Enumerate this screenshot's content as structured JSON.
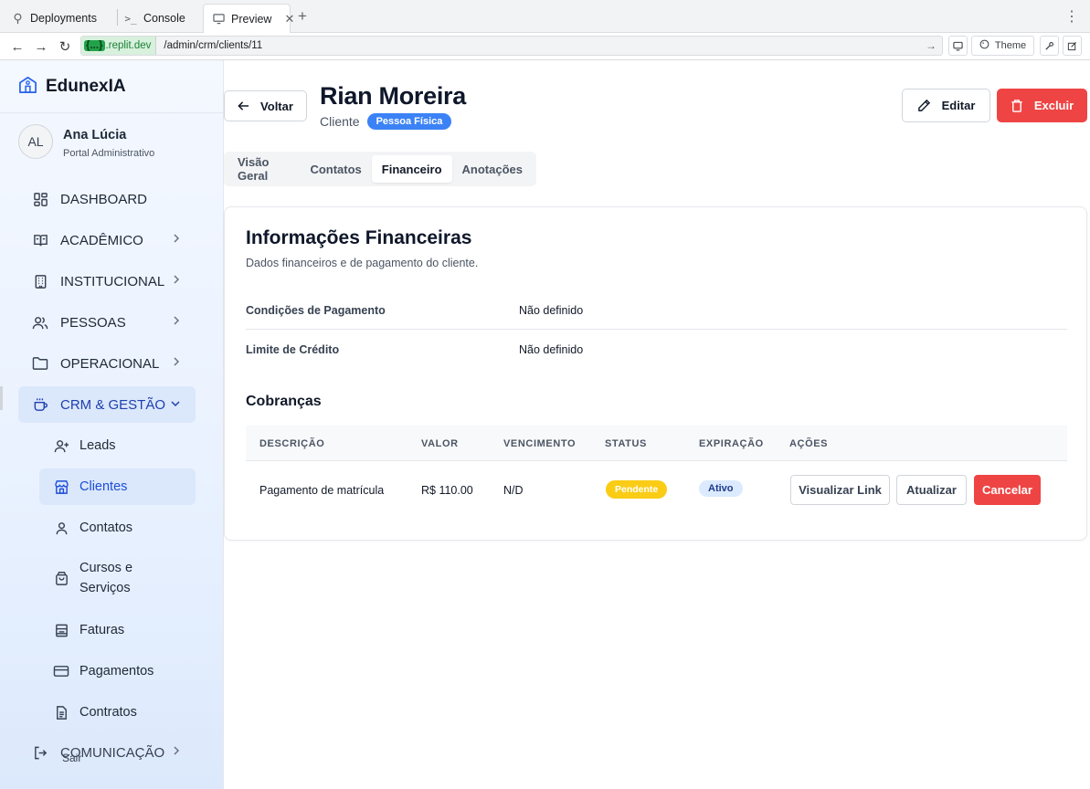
{
  "browser": {
    "tabs": [
      {
        "label": "Deployments",
        "icon": "tree-icon"
      },
      {
        "label": "Console",
        "icon": "terminal-icon"
      },
      {
        "label": "Preview",
        "icon": "monitor-icon"
      }
    ],
    "url_host_badge": "{...}",
    "url_host": ".replit.dev",
    "url_path": "/admin/crm/clients/11",
    "theme_label": "Theme"
  },
  "sidebar": {
    "brand": "EdunexIA",
    "user": {
      "initials": "AL",
      "name": "Ana Lúcia",
      "role": "Portal Administrativo"
    },
    "items": [
      {
        "label": "DASHBOARD",
        "icon": "dashboard-icon"
      },
      {
        "label": "ACADÊMICO",
        "icon": "book-icon"
      },
      {
        "label": "INSTITUCIONAL",
        "icon": "building-icon"
      },
      {
        "label": "PESSOAS",
        "icon": "users-icon"
      },
      {
        "label": "OPERACIONAL",
        "icon": "folder-icon"
      },
      {
        "label": "CRM & GESTÃO",
        "icon": "cup-icon"
      }
    ],
    "subitems": [
      {
        "label": "Leads",
        "icon": "user-plus-icon"
      },
      {
        "label": "Clientes",
        "icon": "store-icon"
      },
      {
        "label": "Contatos",
        "icon": "user-icon"
      },
      {
        "label": "Cursos e Serviços",
        "icon": "shopping-bag-icon"
      },
      {
        "label": "Faturas",
        "icon": "receipt-icon"
      },
      {
        "label": "Pagamentos",
        "icon": "credit-card-icon"
      },
      {
        "label": "Contratos",
        "icon": "file-text-icon"
      }
    ],
    "bottom_item": "COMUNICAÇÃO",
    "logout": "Sair"
  },
  "header": {
    "back_label": "Voltar",
    "title": "Rian Moreira",
    "subtitle": "Cliente",
    "type_badge": "Pessoa Física",
    "edit_label": "Editar",
    "delete_label": "Excluir"
  },
  "tabs": [
    "Visão Geral",
    "Contatos",
    "Financeiro",
    "Anotações"
  ],
  "active_tab": "Financeiro",
  "financial": {
    "title": "Informações Financeiras",
    "description": "Dados financeiros e de pagamento do cliente.",
    "fields": [
      {
        "label": "Condições de Pagamento",
        "value": "Não definido"
      },
      {
        "label": "Limite de Crédito",
        "value": "Não definido"
      }
    ]
  },
  "charges": {
    "title": "Cobranças",
    "columns": [
      "DESCRIÇÃO",
      "VALOR",
      "VENCIMENTO",
      "STATUS",
      "EXPIRAÇÃO",
      "AÇÕES"
    ],
    "rows": [
      {
        "description": "Pagamento de matrícula",
        "value": "R$ 110.00",
        "due": "N/D",
        "status": "Pendente",
        "expiration": "Ativo",
        "actions": [
          "Visualizar Link",
          "Atualizar",
          "Cancelar"
        ]
      }
    ]
  },
  "colors": {
    "accent": "#3b82f6",
    "danger": "#ef4444",
    "warning": "#facc15"
  }
}
